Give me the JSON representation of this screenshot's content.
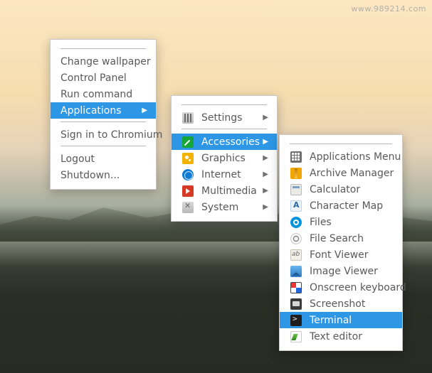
{
  "watermark": "www.989214.com",
  "context_menu": {
    "items": [
      {
        "label": "Change wallpaper",
        "has_submenu": false
      },
      {
        "label": "Control Panel",
        "has_submenu": false
      },
      {
        "label": "Run command",
        "has_submenu": false
      },
      {
        "label": "Applications",
        "has_submenu": true,
        "highlighted": true
      }
    ],
    "secondary_items": [
      {
        "label": "Sign in to Chromium",
        "has_submenu": false
      }
    ],
    "tertiary_items": [
      {
        "label": "Logout",
        "has_submenu": false
      },
      {
        "label": "Shutdown...",
        "has_submenu": false
      }
    ]
  },
  "applications_menu": {
    "top": [
      {
        "label": "Settings",
        "icon": "settings",
        "has_submenu": true
      }
    ],
    "categories": [
      {
        "label": "Accessories",
        "icon": "accessories",
        "has_submenu": true,
        "highlighted": true
      },
      {
        "label": "Graphics",
        "icon": "graphics",
        "has_submenu": true
      },
      {
        "label": "Internet",
        "icon": "internet",
        "has_submenu": true
      },
      {
        "label": "Multimedia",
        "icon": "multimedia",
        "has_submenu": true
      },
      {
        "label": "System",
        "icon": "system",
        "has_submenu": true
      }
    ]
  },
  "accessories_menu": {
    "items": [
      {
        "label": "Applications Menu",
        "icon": "appsmenu"
      },
      {
        "label": "Archive Manager",
        "icon": "archive"
      },
      {
        "label": "Calculator",
        "icon": "calc"
      },
      {
        "label": "Character Map",
        "icon": "charmap"
      },
      {
        "label": "Files",
        "icon": "files"
      },
      {
        "label": "File Search",
        "icon": "filesearch"
      },
      {
        "label": "Font Viewer",
        "icon": "fontviewer"
      },
      {
        "label": "Image Viewer",
        "icon": "imageviewer"
      },
      {
        "label": "Onscreen keyboard",
        "icon": "onscreen"
      },
      {
        "label": "Screenshot",
        "icon": "screenshot"
      },
      {
        "label": "Terminal",
        "icon": "terminal",
        "highlighted": true
      },
      {
        "label": "Text editor",
        "icon": "texteditor"
      }
    ]
  }
}
